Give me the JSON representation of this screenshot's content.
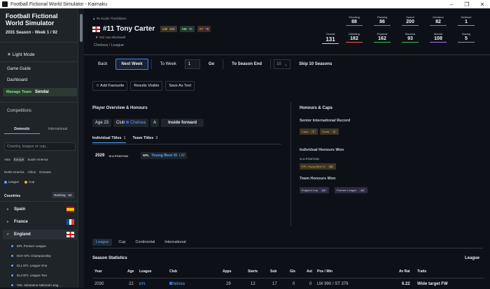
{
  "window": {
    "title": "Football Fictional World Simulator - Kaimaku",
    "controls": [
      "–",
      "❐",
      "✕"
    ]
  },
  "sidebar": {
    "app_title": "Football Fictional World Simulator",
    "season": "2031 Season - Week 1 / 92",
    "light_mode": "☀ Light Mode",
    "game_guide": "Game Guide",
    "dashboard": "Dashboard",
    "manage_label": "Manage Team",
    "manage_team": "Sendai",
    "competitions": "Competitions",
    "tab_domestic": "Domestic",
    "tab_international": "International",
    "search_placeholder": "Country, league or cup...",
    "regions1": [
      "Asia",
      "Europe",
      "South America"
    ],
    "regions2": [
      "North America",
      "Africa",
      "Oceania"
    ],
    "legend_league": "League",
    "legend_cup": "Cup",
    "countries_header": "Countries",
    "ranking": "Ranking - 54",
    "countries": [
      {
        "name": "Spain",
        "caret": "▸"
      },
      {
        "name": "France",
        "caret": "▸"
      },
      {
        "name": "England",
        "caret": "▾"
      }
    ],
    "leagues": [
      "EPL Premier League",
      "ECH EFL Championship",
      "EL1 EFL League One",
      "EL2 EFL League Two",
      "VNL Vanarama National Leag..."
    ]
  },
  "player": {
    "position_line": "▲ #6 Scalin Thorkildsen",
    "name": "#11 Tony Carter",
    "attrs": [
      {
        "pos": "LW",
        "val": "100"
      },
      {
        "pos": "AM",
        "val": "75"
      },
      {
        "pos": "ST",
        "val": "75"
      }
    ],
    "scout_line": "▼ #33 Ivan Blackwell",
    "club_league": "Chelsea / League",
    "overall_label": "Overall",
    "overall": "131",
    "stats": [
      {
        "label": "Shooting",
        "value": "88",
        "color": "#f85149"
      },
      {
        "label": "Passing",
        "value": "86",
        "color": "#f85149"
      },
      {
        "label": "Speed",
        "value": "200",
        "color": "#3fb950"
      },
      {
        "label": "Decision",
        "value": "82",
        "color": "#f85149"
      },
      {
        "label": "Defense",
        "value": "1",
        "color": "#8b949e"
      },
      {
        "label": "Dribbling",
        "value": "182",
        "color": "#f85149"
      },
      {
        "label": "Physical",
        "value": "162",
        "color": "#3fb950"
      },
      {
        "label": "Stamina",
        "value": "93",
        "color": "#3fb950"
      },
      {
        "label": "Mental",
        "value": "108",
        "color": "#a371f7"
      },
      {
        "label": "Saving",
        "value": "5",
        "color": "#8b949e"
      }
    ]
  },
  "nav": {
    "back": "Back",
    "next_week": "Next Week",
    "to_week": "To Week",
    "week_value": "1",
    "go": "Go",
    "to_season_end": "To Season End",
    "skip_value": "10",
    "skip_chevron": "⌄",
    "skip_label": "Skip 10 Seasons"
  },
  "actions": {
    "favourite": "☆ Add Favourite",
    "results": "Results Visible",
    "save_text": "Save As Text"
  },
  "overview": {
    "header": "Player Overview & Honours",
    "age": "Age 23",
    "club_label": "Club",
    "club_name": "Chelsea",
    "foot": "A",
    "role": "Inside forward",
    "tab_individual": "Individual Titles",
    "tab_individual_count": "1",
    "tab_team": "Team Titles",
    "tab_team_count": "3",
    "titles": [
      {
        "year": "2029",
        "type": "XI A POSITION",
        "league": "EPL",
        "award": "Young Best XI",
        "pos": "LW"
      }
    ]
  },
  "honours": {
    "header": "Honours & Caps",
    "intl_header": "Senior International Record",
    "caps_label": "Caps",
    "caps": "7",
    "goals_label": "Goals",
    "goals": "1",
    "ind_header": "Individual Honours Won",
    "ind_sub": "XI A POSITION",
    "ind_badge": "EPL Young Best XI",
    "ind_count": "x1",
    "team_header": "Team Honours Won",
    "team_badges": [
      {
        "label": "England Cup",
        "count": "x2"
      },
      {
        "label": "Premier League",
        "count": "x1"
      }
    ]
  },
  "bottom_tabs": [
    "League",
    "Cup",
    "Continental",
    "International"
  ],
  "season_stats": {
    "title": "Season Statistics",
    "right_label": "League",
    "headers": [
      "Year",
      "Age",
      "League",
      "Club",
      "Apps",
      "Starts",
      "Sub",
      "Gls",
      "Ast",
      "Pos / Min",
      "Av Rat",
      "Traits"
    ],
    "row": [
      "2030",
      "22",
      "EPL",
      "Chelsea",
      "29",
      "12",
      "17",
      "0",
      "0",
      "LW 990 / ST 379",
      "6.22",
      "Wide target FW"
    ]
  }
}
